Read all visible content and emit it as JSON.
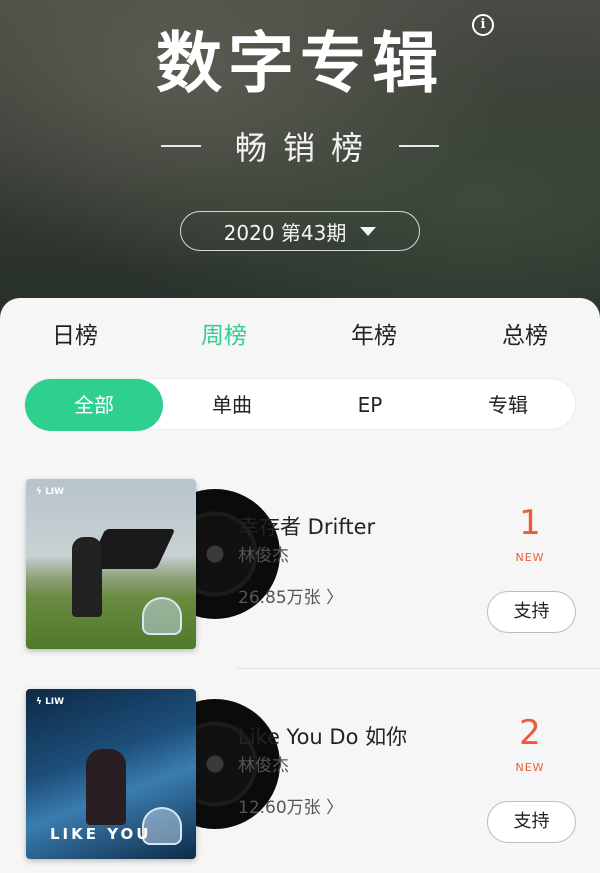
{
  "header": {
    "title": "数字专辑",
    "info_icon": "i",
    "subtitle": "畅销榜",
    "period": "2020 第43期"
  },
  "tabs": [
    {
      "label": "日榜",
      "active": false
    },
    {
      "label": "周榜",
      "active": true
    },
    {
      "label": "年榜",
      "active": false
    },
    {
      "label": "总榜",
      "active": false
    }
  ],
  "segments": [
    {
      "label": "全部",
      "active": true
    },
    {
      "label": "单曲",
      "active": false
    },
    {
      "label": "EP",
      "active": false
    },
    {
      "label": "专辑",
      "active": false
    }
  ],
  "albums": [
    {
      "title": "幸存者 Drifter",
      "artist": "林俊杰",
      "sales": "26.85万张 〉",
      "rank": "1",
      "tag": "NEW",
      "button": "支持",
      "cover_logo": "ϟ LIW"
    },
    {
      "title": "Like You Do 如你",
      "artist": "林俊杰",
      "sales": "12.60万张 〉",
      "rank": "2",
      "tag": "NEW",
      "button": "支持",
      "cover_logo": "ϟ LIW",
      "cover_text": "LIKE YOU"
    }
  ],
  "colors": {
    "accent": "#2fcf8f",
    "rank": "#ee5a3b"
  }
}
